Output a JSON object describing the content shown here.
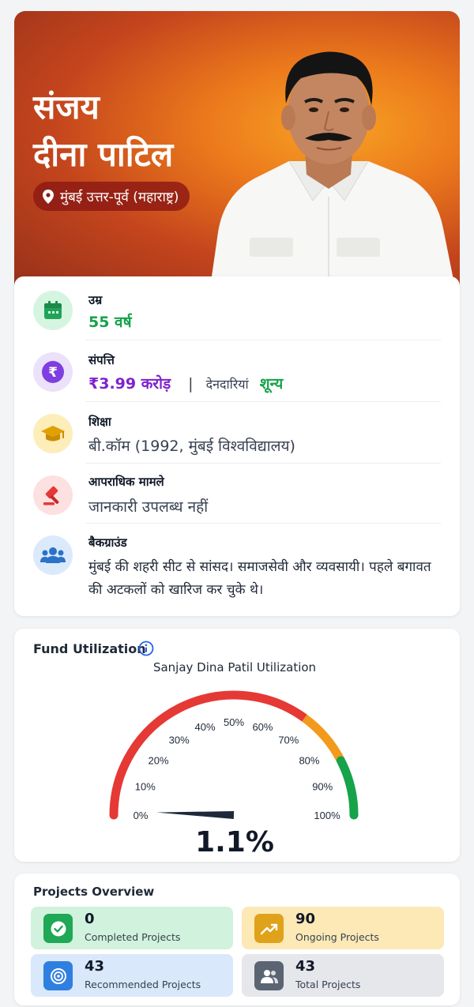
{
  "hero": {
    "name_line1": "संजय",
    "name_line2": "दीना पाटिल",
    "location": "मुंबई उत्तर-पूर्व (महाराष्ट्र)"
  },
  "info": {
    "age": {
      "label": "उम्र",
      "value": "55 वर्ष"
    },
    "assets": {
      "label": "संपत्ति",
      "value": "₹3.99 करोड़",
      "separator": "|",
      "liabilities_label": "देनदारियां",
      "liabilities_value": "शून्य"
    },
    "education": {
      "label": "शिक्षा",
      "value": "बी.कॉम (1992, मुंबई विश्वविद्यालय)"
    },
    "criminal": {
      "label": "आपराधिक मामले",
      "value": "जानकारी उपलब्ध नहीं"
    },
    "background": {
      "label": "बैकग्राउंड",
      "value": "मुंबई की शहरी सीट से सांसद। समाजसेवी और व्यवसायी। पहले बगावत की अटकलों को खारिज कर चुके थे।"
    }
  },
  "fund": {
    "title": "Fund Utilization",
    "chart_title": "Sanjay Dina Patil Utilization",
    "value_label": "1.1%"
  },
  "chart_data": {
    "type": "gauge",
    "title": "Sanjay Dina Patil Utilization",
    "value": 1.1,
    "min": 0,
    "max": 100,
    "ticks": [
      "0%",
      "10%",
      "20%",
      "30%",
      "40%",
      "50%",
      "60%",
      "70%",
      "80%",
      "90%",
      "100%"
    ],
    "bands": [
      {
        "from": 0,
        "to": 70,
        "color": "#e53935"
      },
      {
        "from": 70,
        "to": 85,
        "color": "#f29a1c"
      },
      {
        "from": 85,
        "to": 100,
        "color": "#16a34a"
      }
    ]
  },
  "projects": {
    "title": "Projects Overview",
    "completed": {
      "value": "0",
      "label": "Completed Projects"
    },
    "ongoing": {
      "value": "90",
      "label": "Ongoing Projects"
    },
    "recommended": {
      "value": "43",
      "label": "Recommended Projects"
    },
    "total": {
      "value": "43",
      "label": "Total Projects"
    }
  },
  "colors": {
    "green": "#16a34a",
    "purple": "#7e22ce",
    "completed_bg": "#d1f2dc",
    "ongoing_bg": "#fde9b6",
    "recommended_bg": "#d9e8fb",
    "total_bg": "#e5e7eb"
  }
}
